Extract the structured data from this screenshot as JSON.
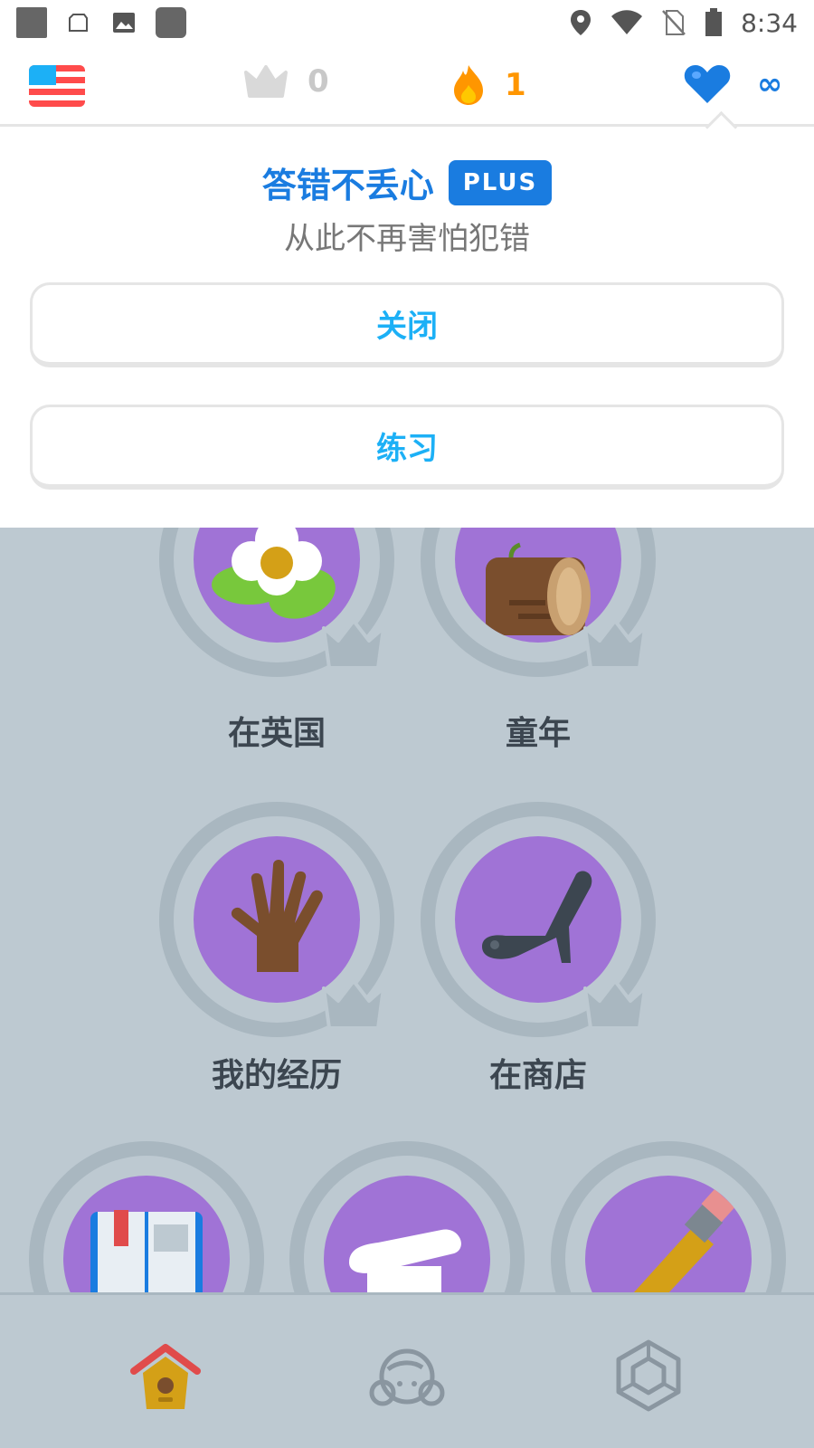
{
  "status_bar": {
    "time": "8:34"
  },
  "top_bar": {
    "language_flag": "us-flag-icon",
    "crowns": "0",
    "streak": "1",
    "hearts": "∞"
  },
  "popup": {
    "title": "答错不丢心",
    "badge": "PLUS",
    "subtitle": "从此不再害怕犯错",
    "close_label": "关闭",
    "practice_label": "练习"
  },
  "skills": [
    {
      "label": "在英国",
      "icon": "flower-icon"
    },
    {
      "label": "童年",
      "icon": "log-icon"
    },
    {
      "label": "我的经历",
      "icon": "hand-icon"
    },
    {
      "label": "在商店",
      "icon": "high-heel-icon"
    },
    {
      "label": "",
      "icon": "book-icon"
    },
    {
      "label": "",
      "icon": "bread-icon"
    },
    {
      "label": "",
      "icon": "pencil-icon"
    }
  ],
  "colors": {
    "brand_blue": "#1a7ce0",
    "button_text": "#1cb0f6",
    "skill_disc": "#a073d6",
    "background": "#bdc9d1",
    "streak": "#ff9600"
  },
  "bottom_nav": [
    "home-icon",
    "profile-icon",
    "shop-icon"
  ]
}
